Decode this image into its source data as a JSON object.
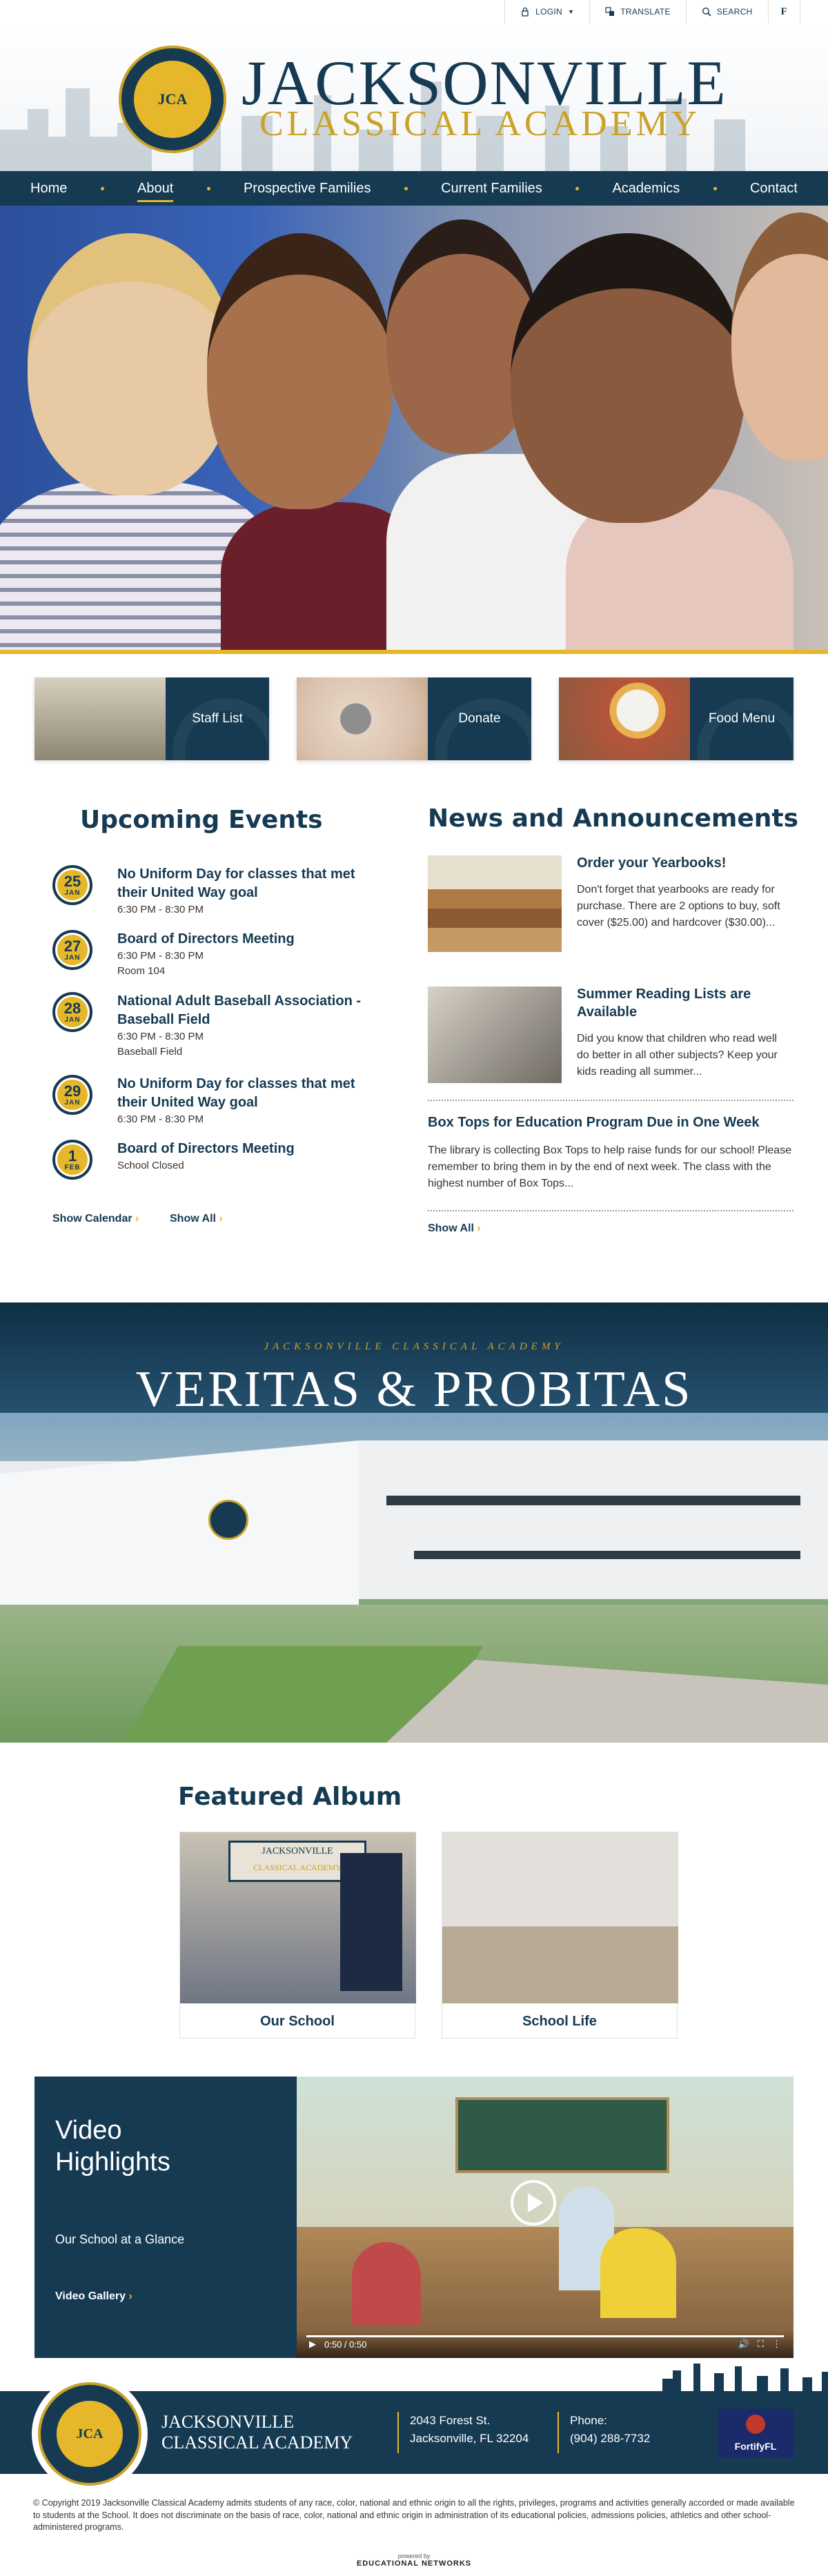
{
  "utility": {
    "login": "LOGIN",
    "translate": "TRANSLATE",
    "search": "SEARCH"
  },
  "brand": {
    "line1": "JACKSONVILLE",
    "line2": "CLASSICAL ACADEMY",
    "seal_initials": "JCA"
  },
  "nav": [
    "Home",
    "About",
    "Prospective Families",
    "Current Families",
    "Academics",
    "Contact"
  ],
  "quick_links": [
    "Staff List",
    "Donate",
    "Food Menu"
  ],
  "events": {
    "title": "Upcoming Events",
    "items": [
      {
        "day": "25",
        "month": "JAN",
        "title": "No Uniform Day for classes that met their United Way goal",
        "time": "6:30 PM - 8:30 PM",
        "place": ""
      },
      {
        "day": "27",
        "month": "JAN",
        "title": "Board of Directors Meeting",
        "time": "6:30 PM - 8:30 PM",
        "place": "Room 104"
      },
      {
        "day": "28",
        "month": "JAN",
        "title": "National Adult Baseball Association - Baseball Field",
        "time": "6:30 PM - 8:30 PM",
        "place": "Baseball Field"
      },
      {
        "day": "29",
        "month": "JAN",
        "title": "No Uniform Day for classes that met their United Way goal",
        "time": "6:30 PM - 8:30 PM",
        "place": ""
      },
      {
        "day": "1",
        "month": "FEB",
        "title": "Board of Directors Meeting",
        "time": "School Closed",
        "place": ""
      }
    ],
    "show_calendar": "Show Calendar",
    "show_all": "Show All"
  },
  "news": {
    "title": "News and Announcements",
    "items": [
      {
        "title": "Order your Yearbooks!",
        "body": "Don't forget that yearbooks are ready for purchase. There are 2 options to buy, soft cover ($25.00) and hardcover ($30.00)..."
      },
      {
        "title": "Summer Reading Lists are Available",
        "body": "Did you know that children who read well do better in all other subjects? Keep your kids reading all summer..."
      },
      {
        "title": "Box Tops for Education Program Due in One Week",
        "body": "The library is collecting Box Tops to help raise funds for our school! Please remember to bring them in by the end of next week. The class with the highest number of Box Tops..."
      }
    ],
    "show_all": "Show All"
  },
  "veritas": {
    "subtitle": "JACKSONVILLE CLASSICAL ACADEMY",
    "title": "VERITAS & PROBITAS"
  },
  "album": {
    "title": "Featured Album",
    "items": [
      "Our School",
      "School Life"
    ],
    "banner_line1": "JACKSONVILLE",
    "banner_line2": "CLASSICAL ACADEMY"
  },
  "video": {
    "title": "Video Highlights",
    "subtitle": "Our School at a Glance",
    "gallery": "Video Gallery",
    "time": "0:50 / 0:50"
  },
  "footer": {
    "name1": "JACKSONVILLE",
    "name2": "CLASSICAL ACADEMY",
    "address1": "2043 Forest St.",
    "address2": "Jacksonville, FL 32204",
    "phone_label": "Phone:",
    "phone": "(904) 288-7732",
    "badge": "FortifyFL"
  },
  "copyright": "© Copyright 2019 Jacksonville Classical Academy admits students of any race, color, national and ethnic origin to all the rights, privileges, programs and activities generally accorded or made available to students at the School. It does not discriminate on the basis of race, color, national and ethnic origin in administration of its educational policies, admissions policies, athletics and other school-administered programs.",
  "powered": {
    "label": "powered by",
    "name": "EDUCATIONAL NETWORKS"
  },
  "colors": {
    "navy": "#153a52",
    "gold": "#e6b72a"
  }
}
